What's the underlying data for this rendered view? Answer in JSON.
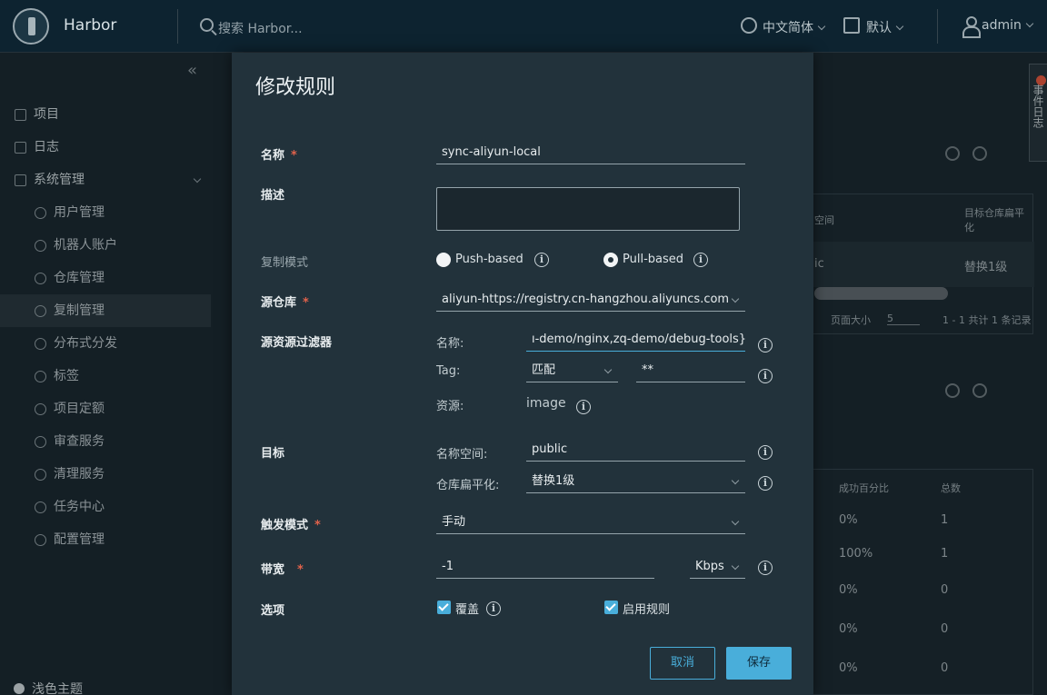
{
  "header": {
    "brand": "Harbor",
    "search_placeholder": "搜索 Harbor...",
    "language": "中文简体",
    "datetime": "默认",
    "user": "admin"
  },
  "sidebar": {
    "items": [
      {
        "label": "项目",
        "icon": "project-icon"
      },
      {
        "label": "日志",
        "icon": "log-icon"
      },
      {
        "label": "系统管理",
        "icon": "admin-icon"
      },
      {
        "label": "用户管理",
        "icon": "user-icon"
      },
      {
        "label": "机器人账户",
        "icon": "robot-icon"
      },
      {
        "label": "仓库管理",
        "icon": "box-icon"
      },
      {
        "label": "复制管理",
        "icon": "cloud-icon"
      },
      {
        "label": "分布式分发",
        "icon": "share-icon"
      },
      {
        "label": "标签",
        "icon": "tag-icon"
      },
      {
        "label": "项目定额",
        "icon": "dashboard-icon"
      },
      {
        "label": "审查服务",
        "icon": "shield-icon"
      },
      {
        "label": "清理服务",
        "icon": "trash-icon"
      },
      {
        "label": "任务中心",
        "icon": "clock-icon"
      },
      {
        "label": "配置管理",
        "icon": "gear-icon"
      }
    ],
    "theme": "浅色主题"
  },
  "background": {
    "event_log_tab": "事件日志",
    "table1": {
      "headers": [
        "空间",
        "目标仓库扁平化"
      ],
      "row": [
        "ic",
        "替换1级"
      ],
      "page_size_label": "页面大小",
      "page_size": "5",
      "count": "1 - 1 共计 1 条记录"
    },
    "table2": {
      "headers": [
        "成功百分比",
        "总数"
      ],
      "rows": [
        [
          "0%",
          "1"
        ],
        [
          "100%",
          "1"
        ],
        [
          "0%",
          "0"
        ],
        [
          "0%",
          "0"
        ],
        [
          "0%",
          "0"
        ]
      ]
    }
  },
  "modal": {
    "title": "修改规则",
    "name_label": "名称",
    "name_value": "sync-aliyun-local",
    "desc_label": "描述",
    "mode_label": "复制模式",
    "push_label": "Push-based",
    "pull_label": "Pull-based",
    "selected_mode": "Pull-based",
    "src_registry_label": "源仓库",
    "src_registry_value": "aliyun-https://registry.cn-hangzhou.aliyuncs.com",
    "filter_label": "源资源过滤器",
    "filter_name_label": "名称:",
    "filter_name_value": "ı-demo/nginx,zq-demo/debug-tools}",
    "filter_tag_label": "Tag:",
    "filter_tag_match": "匹配",
    "filter_tag_value": "**",
    "filter_resource_label": "资源:",
    "filter_resource_value": "image",
    "target_label": "目标",
    "namespace_label": "名称空间:",
    "namespace_value": "public",
    "flatten_label": "仓库扁平化:",
    "flatten_value": "替换1级",
    "trigger_label": "触发模式",
    "trigger_value": "手动",
    "bandwidth_label": "带宽",
    "bandwidth_value": "-1",
    "bandwidth_unit": "Kbps",
    "options_label": "选项",
    "override_label": "覆盖",
    "enable_label": "启用规则",
    "override_checked": true,
    "enable_checked": true,
    "cancel_label": "取消",
    "save_label": "保存"
  },
  "colors": {
    "accent": "#49aeda",
    "required": "#e2624b",
    "modal_bg": "#22323b",
    "header_bg": "#0d2330"
  }
}
